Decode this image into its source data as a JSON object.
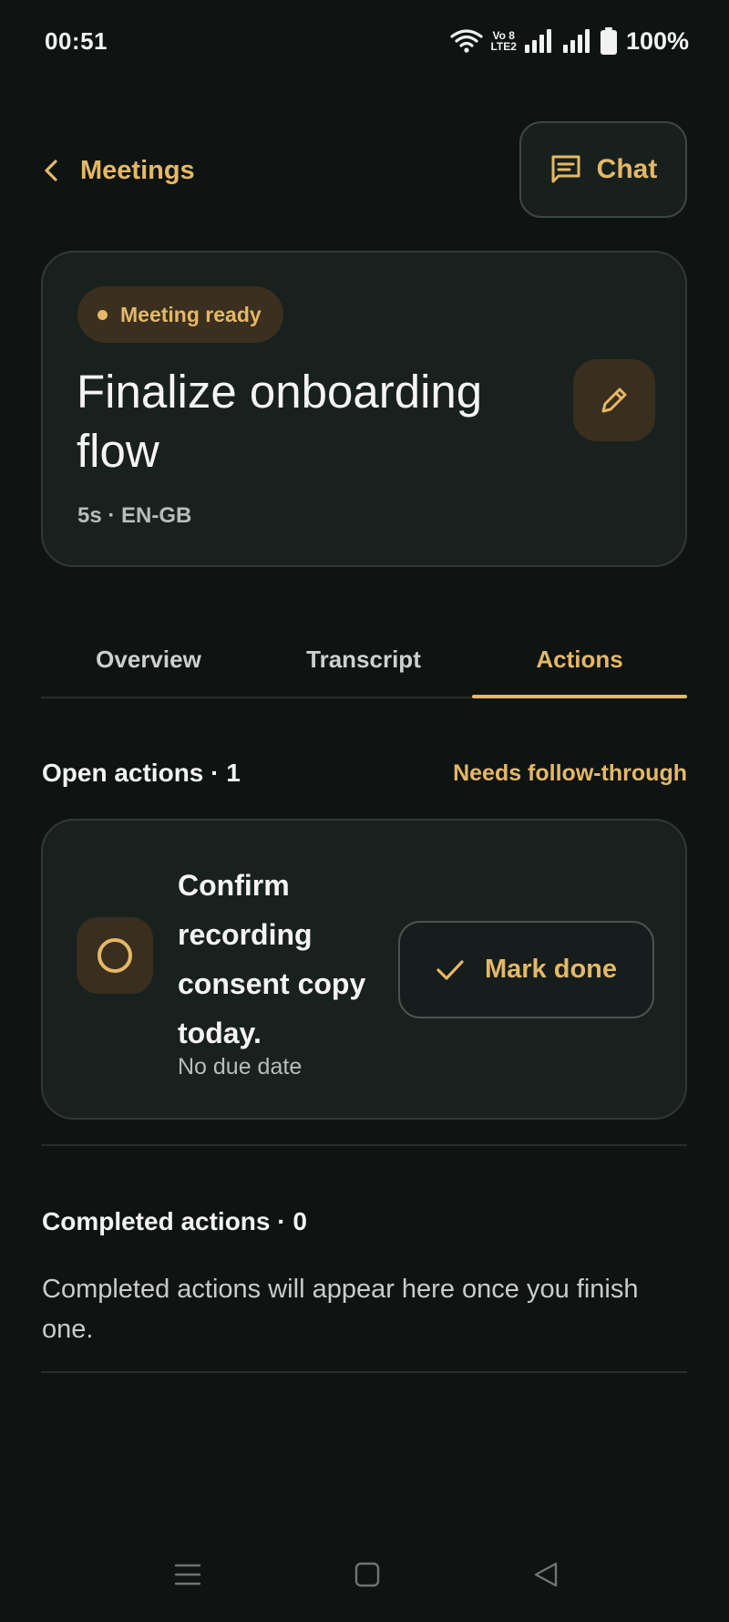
{
  "status_bar": {
    "time": "00:51",
    "volte_top": "Vo 8",
    "volte_bottom": "LTE2",
    "battery": "100%"
  },
  "header": {
    "back_label": "Meetings",
    "chat_label": "Chat"
  },
  "meeting": {
    "status": "Meeting ready",
    "title": "Finalize onboarding flow",
    "meta": "5s · EN-GB"
  },
  "tabs": [
    {
      "label": "Overview",
      "active": false
    },
    {
      "label": "Transcript",
      "active": false
    },
    {
      "label": "Actions",
      "active": true
    }
  ],
  "open_actions": {
    "heading": "Open actions · 1",
    "link": "Needs follow-through",
    "items": [
      {
        "text": "Confirm recording consent copy today.",
        "due": "No due date",
        "button": "Mark done"
      }
    ]
  },
  "completed_actions": {
    "heading": "Completed actions · 0",
    "empty_text": "Completed actions will appear here once you finish one."
  },
  "colors": {
    "background": "#0f1413",
    "card": "#19211f",
    "accent": "#e4b866",
    "accent_surface": "#3a2e1e"
  },
  "icons": {
    "back": "chevron-left-icon",
    "chat": "chat-bubble-icon",
    "edit": "pencil-icon",
    "toggle": "circle-outline-icon",
    "done": "checkmark-icon",
    "nav_menu": "menu-lines-icon",
    "nav_home": "square-home-icon",
    "nav_back": "triangle-back-icon"
  }
}
